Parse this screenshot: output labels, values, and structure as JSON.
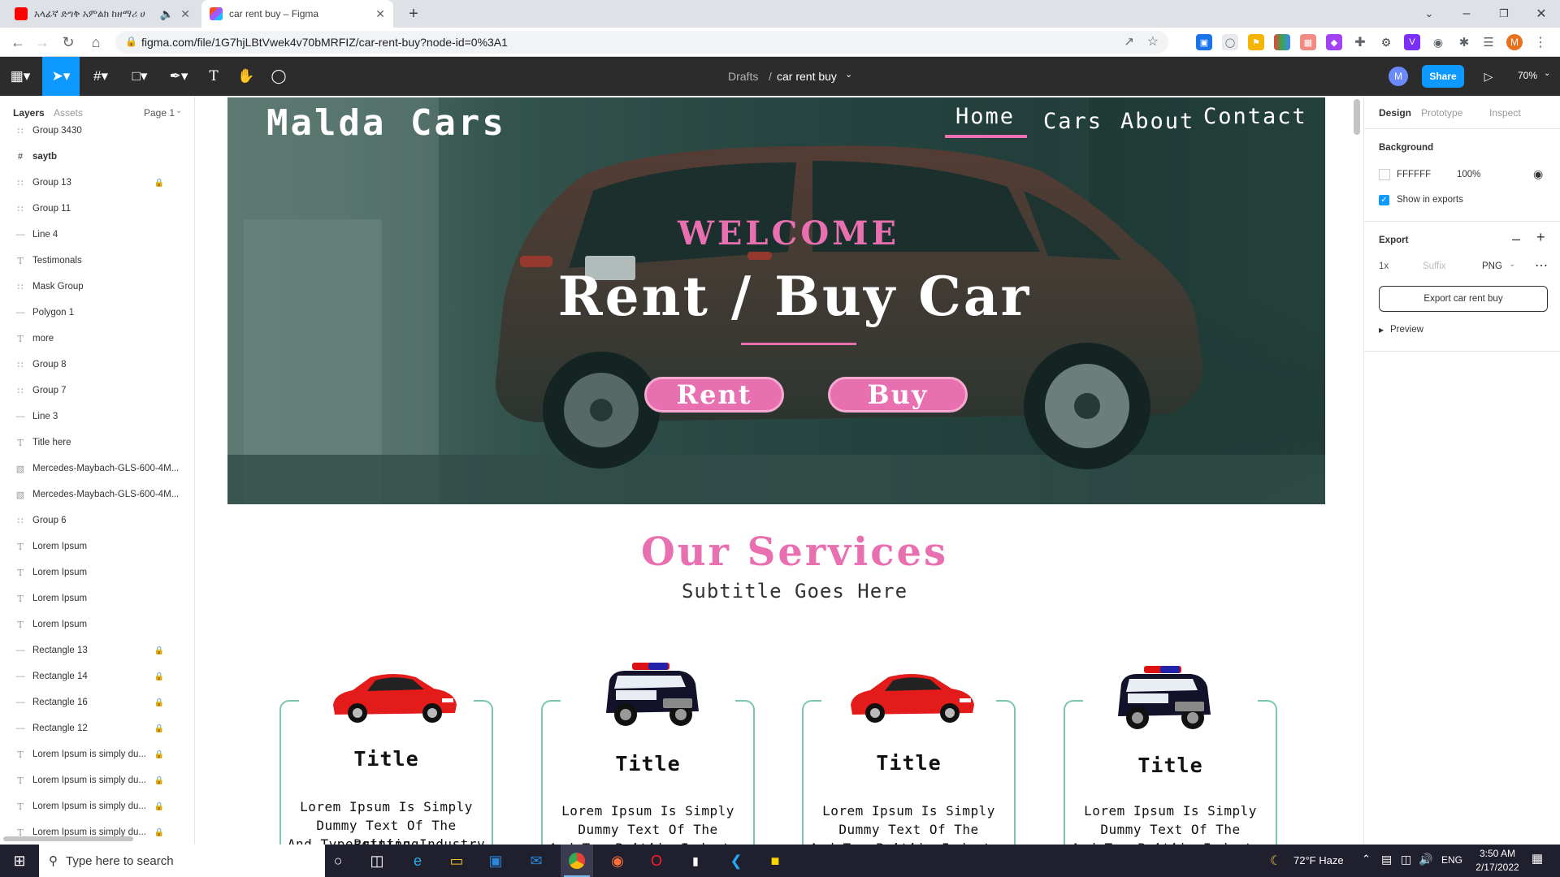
{
  "browser": {
    "tabs": [
      {
        "title": "አላፊኛ ድግቅ አምልክ ከዘማሪ ሀ",
        "favicon_color": "#ff0000"
      },
      {
        "title": "car rent buy – Figma",
        "favicon_color": "#f24e1e"
      }
    ],
    "url": "figma.com/file/1G7hjLBtVwek4v70bMRFIZ/car-rent-buy?node-id=0%3A1",
    "profile_initial": "M"
  },
  "figma": {
    "breadcrumb_parent": "Drafts",
    "breadcrumb_sep": "/",
    "file_name": "car rent buy",
    "share_label": "Share",
    "zoom": "70%",
    "avatar_initial": "M",
    "left_tabs": {
      "layers": "Layers",
      "assets": "Assets",
      "page": "Page 1"
    },
    "layers": [
      {
        "name": "Group 3430",
        "icon": "group",
        "locked": false
      },
      {
        "name": "saytb",
        "icon": "frame",
        "locked": false,
        "bold": true
      },
      {
        "name": "Group 13",
        "icon": "group",
        "locked": true
      },
      {
        "name": "Group 11",
        "icon": "group",
        "locked": false
      },
      {
        "name": "Line 4",
        "icon": "line",
        "locked": false
      },
      {
        "name": "Testimonals",
        "icon": "text",
        "locked": false
      },
      {
        "name": "Mask Group",
        "icon": "group",
        "locked": false
      },
      {
        "name": "Polygon 1",
        "icon": "line",
        "locked": false
      },
      {
        "name": "more",
        "icon": "text",
        "locked": false
      },
      {
        "name": "Group 8",
        "icon": "group",
        "locked": false
      },
      {
        "name": "Group 7",
        "icon": "group",
        "locked": false
      },
      {
        "name": "Line 3",
        "icon": "line",
        "locked": false
      },
      {
        "name": "Title here",
        "icon": "text",
        "locked": false
      },
      {
        "name": "Mercedes-Maybach-GLS-600-4M...",
        "icon": "image",
        "locked": false
      },
      {
        "name": "Mercedes-Maybach-GLS-600-4M...",
        "icon": "image",
        "locked": false
      },
      {
        "name": "Group 6",
        "icon": "group",
        "locked": false
      },
      {
        "name": "Lorem Ipsum",
        "icon": "text",
        "locked": false
      },
      {
        "name": "Lorem Ipsum",
        "icon": "text",
        "locked": false
      },
      {
        "name": "Lorem Ipsum",
        "icon": "text",
        "locked": false
      },
      {
        "name": "Lorem Ipsum",
        "icon": "text",
        "locked": false
      },
      {
        "name": "Rectangle 13",
        "icon": "line",
        "locked": true
      },
      {
        "name": "Rectangle 14",
        "icon": "line",
        "locked": true
      },
      {
        "name": "Rectangle 16",
        "icon": "line",
        "locked": true
      },
      {
        "name": "Rectangle 12",
        "icon": "line",
        "locked": true
      },
      {
        "name": "Lorem Ipsum is simply du...",
        "icon": "text",
        "locked": true
      },
      {
        "name": "Lorem Ipsum is simply du...",
        "icon": "text",
        "locked": true
      },
      {
        "name": "Lorem Ipsum is simply du...",
        "icon": "text",
        "locked": true
      },
      {
        "name": "Lorem Ipsum is simply du...",
        "icon": "text",
        "locked": true
      }
    ],
    "right_panel": {
      "tabs": [
        "Design",
        "Prototype",
        "Inspect"
      ],
      "background_label": "Background",
      "bg_hex": "FFFFFF",
      "bg_opacity": "100%",
      "show_in_exports": "Show in exports",
      "export_label": "Export",
      "export_scale": "1x",
      "export_suffix_placeholder": "Suffix",
      "export_format": "PNG",
      "export_button": "Export car rent buy",
      "preview_label": "Preview"
    }
  },
  "design": {
    "brand": "Malda Cars",
    "nav": [
      "Home",
      "Cars",
      "About",
      "Contact"
    ],
    "welcome": "WELCOME",
    "headline": "Rent / Buy Car",
    "btn_rent": "Rent",
    "btn_buy": "Buy",
    "services_title": "Our Services",
    "services_subtitle": "Subtitle Goes Here",
    "cards": [
      {
        "title": "Title",
        "line1": "Lorem Ipsum Is Simply",
        "line2": "Dummy  Text Of The Printing",
        "line3": "And Typesetting Industry",
        "car": "red-car"
      },
      {
        "title": "Title",
        "line1": "Lorem Ipsum Is Simply",
        "line2": "Dummy  Text Of The Printing",
        "line3": "And Typesetting Industry",
        "car": "police-suv"
      },
      {
        "title": "Title",
        "line1": "Lorem Ipsum Is Simply",
        "line2": "Dummy  Text Of The Printing",
        "line3": "And Typesetting Industry",
        "car": "red-car"
      },
      {
        "title": "Title",
        "line1": "Lorem Ipsum Is Simply",
        "line2": "Dummy  Text Of The Printing",
        "line3": "And Typesetting Industry",
        "car": "police-suv"
      }
    ],
    "accent_pink": "#e86fb0",
    "accent_teal": "#7cc5b2"
  },
  "taskbar": {
    "search_placeholder": "Type here to search",
    "weather": "72°F  Haze",
    "lang": "ENG",
    "time": "3:50 AM",
    "date": "2/17/2022"
  },
  "help_label": "?"
}
